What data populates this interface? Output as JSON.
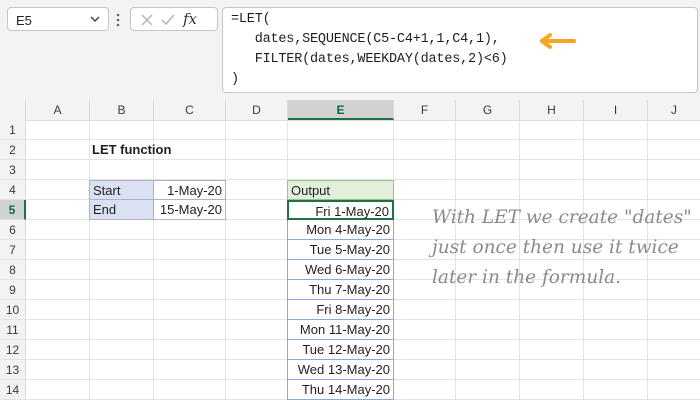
{
  "namebox": {
    "value": "E5"
  },
  "formula": {
    "lines": [
      "=LET(",
      "   dates,SEQUENCE(C5-C4+1,1,C4,1),",
      "   FILTER(dates,WEEKDAY(dates,2)<6)",
      ")"
    ]
  },
  "columns": [
    "A",
    "B",
    "C",
    "D",
    "E",
    "F",
    "G",
    "H",
    "I",
    "J"
  ],
  "rows": [
    "1",
    "2",
    "3",
    "4",
    "5",
    "6",
    "7",
    "8",
    "9",
    "10",
    "11",
    "12",
    "13",
    "14"
  ],
  "title": "LET function",
  "inputs": {
    "start_label": "Start",
    "start_value": "1-May-20",
    "end_label": "End",
    "end_value": "15-May-20"
  },
  "output": {
    "header": "Output",
    "values": [
      "Fri 1-May-20",
      "Mon 4-May-20",
      "Tue 5-May-20",
      "Wed 6-May-20",
      "Thu 7-May-20",
      "Fri 8-May-20",
      "Mon 11-May-20",
      "Tue 12-May-20",
      "Wed 13-May-20",
      "Thu 14-May-20"
    ]
  },
  "note": "With LET we create \"dates\" just once then use it twice later in the formula.",
  "colors": {
    "accent_arrow": "#f5a623",
    "active_green": "#1e7145"
  }
}
